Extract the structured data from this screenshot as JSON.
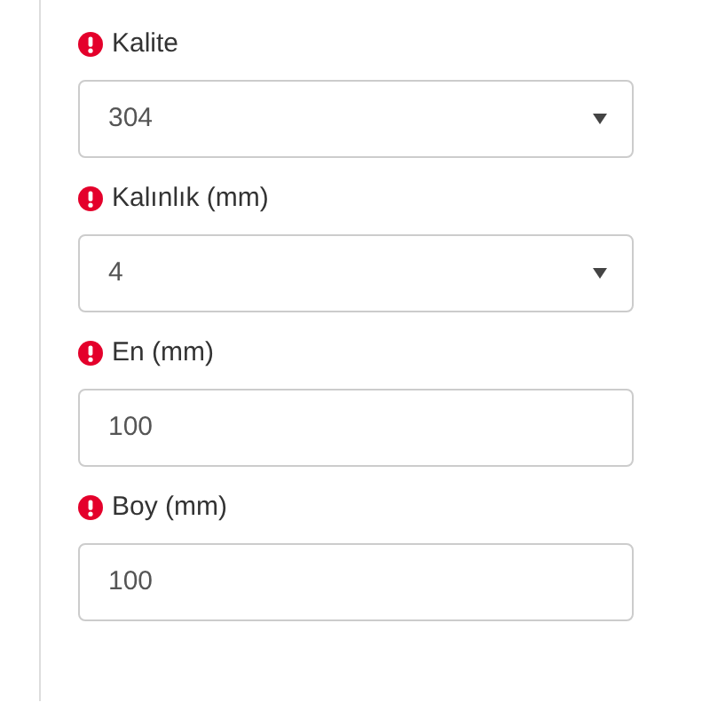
{
  "fields": [
    {
      "label": "Kalite",
      "required": true,
      "kind": "select",
      "value": "304"
    },
    {
      "label": "Kalınlık (mm)",
      "required": true,
      "kind": "select",
      "value": "4"
    },
    {
      "label": "En (mm)",
      "required": true,
      "kind": "input",
      "value": "100"
    },
    {
      "label": "Boy (mm)",
      "required": true,
      "kind": "input",
      "value": "100"
    }
  ]
}
